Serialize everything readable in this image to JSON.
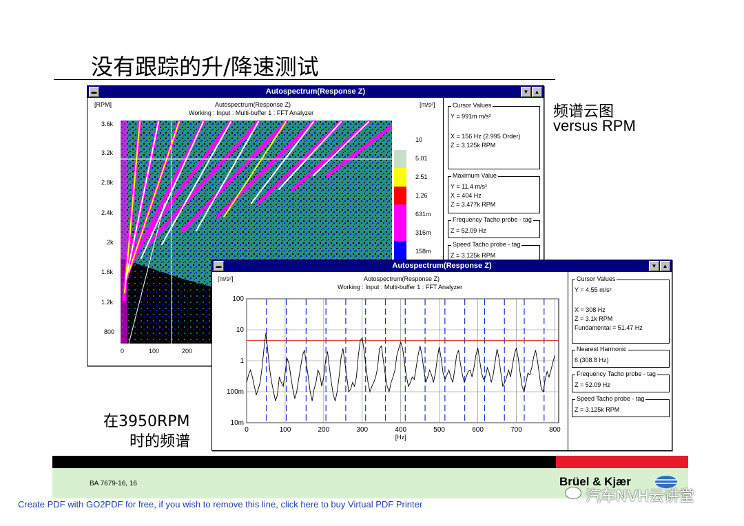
{
  "slide": {
    "title": "没有跟踪的升/降速测试",
    "annotation_top_line1": "频谱云图",
    "annotation_top_line2": "versus RPM",
    "annotation_bottom_line1": "在3950RPM",
    "annotation_bottom_line2": "时的频谱",
    "footer_code": "BA 7679-16, 16",
    "brand": "Brüel & Kjær",
    "watermark": "汽车NVH云讲堂",
    "pdf_notice": "Create PDF with GO2PDF for free, if you wish to remove this line, click here to buy Virtual PDF Printer"
  },
  "window_back": {
    "title": "Autospectrum(Response Z)",
    "plot_title": "Autospectrum(Response Z)",
    "plot_subtitle": "Working : Input : Multi-buffer 1 : FFT Analyzer",
    "y_unit": "[RPM]",
    "z_unit": "[m/s²]",
    "y_ticks": [
      "3.6k",
      "3.2k",
      "2.8k",
      "2.4k",
      "2k",
      "1.6k",
      "1.2k",
      "800"
    ],
    "x_ticks": [
      "0",
      "100",
      "200"
    ],
    "legend": [
      "10",
      "5.01",
      "2.51",
      "1.26",
      "631m",
      "316m",
      "158m"
    ],
    "legend_colors": [
      "#ffffff",
      "#c8e0c8",
      "#ffff00",
      "#ff0000",
      "#ff00ff",
      "#ff00ff",
      "#0000ff"
    ],
    "cursor_values": {
      "header": "Cursor Values",
      "y": "Y = 991m m/s²",
      "x": "X = 156 Hz  (2.995 Order)",
      "z": "Z = 3.125k RPM"
    },
    "maximum_value": {
      "header": "Maximum Value",
      "y": "Y = 11.4 m/s²",
      "x": "X = 404 Hz",
      "z": "Z = 3.477k RPM"
    },
    "freq_tacho": {
      "header": "Frequency Tacho probe - tag",
      "z": "Z = 52.09 Hz"
    },
    "speed_tacho": {
      "header": "Speed Tacho probe - tag",
      "z": "Z = 3.125k RPM"
    }
  },
  "window_front": {
    "title": "Autospectrum(Response Z)",
    "plot_title": "Autospectrum(Response Z)",
    "plot_subtitle": "Working : Input : Multi-buffer 1 : FFT Analyzer",
    "y_unit": "[m/s²]",
    "x_unit": "[Hz]",
    "cursor_values": {
      "header": "Cursor Values",
      "y": "Y = 4.55 m/s²",
      "x": "X = 308 Hz",
      "z": "Z = 3.1k RPM",
      "fund": "Fundamental = 51.47 Hz"
    },
    "nearest_harmonic": {
      "header": "Nearest Harmonic",
      "value": "6  (308.8 Hz)"
    },
    "freq_tacho": {
      "header": "Frequency Tacho probe - tag",
      "z": "Z = 52.09 Hz"
    },
    "speed_tacho": {
      "header": "Speed Tacho probe - tag",
      "z": "Z = 3.125k RPM"
    }
  },
  "chart_data": {
    "type": "line",
    "title": "Autospectrum(Response Z)",
    "subtitle": "Working : Input : Multi-buffer 1 : FFT Analyzer",
    "xlabel": "[Hz]",
    "ylabel": "[m/s²]",
    "xlim": [
      0,
      810
    ],
    "ylim": [
      0.01,
      100
    ],
    "y_scale": "log",
    "x_ticks": [
      0,
      100,
      200,
      300,
      400,
      500,
      600,
      700,
      800
    ],
    "y_tick_labels": [
      "100",
      "10",
      "1",
      "100m",
      "10m"
    ],
    "y_ticks": [
      100,
      10,
      1,
      0.1,
      0.01
    ],
    "cursor_level": 4.55,
    "harmonic_lines": [
      51.47,
      102.94,
      154.41,
      205.88,
      257.35,
      308.82,
      360.29,
      411.76,
      463.23,
      514.7,
      566.17,
      617.64,
      669.11,
      720.58,
      772.05
    ],
    "x": [
      0,
      5,
      10,
      15,
      20,
      25,
      30,
      35,
      40,
      45,
      50,
      55,
      60,
      65,
      70,
      75,
      80,
      85,
      90,
      95,
      100,
      105,
      110,
      115,
      120,
      125,
      130,
      135,
      140,
      145,
      150,
      155,
      160,
      165,
      170,
      175,
      180,
      185,
      190,
      195,
      200,
      205,
      210,
      215,
      220,
      225,
      230,
      235,
      240,
      245,
      250,
      255,
      260,
      265,
      270,
      275,
      280,
      285,
      290,
      295,
      300,
      305,
      310,
      315,
      320,
      325,
      330,
      335,
      340,
      345,
      350,
      355,
      360,
      365,
      370,
      375,
      380,
      385,
      390,
      395,
      400,
      405,
      410,
      415,
      420,
      425,
      430,
      435,
      440,
      445,
      450,
      455,
      460,
      465,
      470,
      475,
      480,
      485,
      490,
      495,
      500,
      505,
      510,
      515,
      520,
      525,
      530,
      535,
      540,
      545,
      550,
      555,
      560,
      565,
      570,
      575,
      580,
      585,
      590,
      595,
      600,
      605,
      610,
      615,
      620,
      625,
      630,
      635,
      640,
      645,
      650,
      655,
      660,
      665,
      670,
      675,
      680,
      685,
      690,
      695,
      700,
      705,
      710,
      715,
      720,
      725,
      730,
      735,
      740,
      745,
      750,
      755,
      760,
      765,
      770,
      775,
      780,
      785,
      790,
      795,
      800,
      805,
      810
    ],
    "series": [
      {
        "values": [
          0.2,
          0.35,
          0.5,
          0.3,
          0.15,
          0.08,
          0.12,
          0.2,
          0.6,
          2.5,
          8,
          2,
          0.5,
          0.2,
          0.1,
          0.05,
          0.08,
          0.3,
          0.2,
          0.15,
          0.4,
          1.2,
          0.8,
          0.3,
          0.12,
          0.06,
          0.1,
          0.25,
          0.6,
          1.5,
          2.2,
          0.8,
          0.3,
          0.1,
          0.05,
          0.12,
          0.2,
          0.5,
          0.35,
          0.15,
          0.3,
          1,
          2,
          0.6,
          0.2,
          0.08,
          0.05,
          0.1,
          0.3,
          1.2,
          2.5,
          0.9,
          0.3,
          0.1,
          0.12,
          0.2,
          0.15,
          0.3,
          1.5,
          4.5,
          5.5,
          2,
          0.6,
          0.2,
          0.1,
          0.15,
          0.2,
          0.3,
          0.6,
          2.5,
          3,
          1,
          0.35,
          0.15,
          0.1,
          0.2,
          0.3,
          0.5,
          1.5,
          2.5,
          4,
          2.5,
          0.8,
          0.3,
          0.15,
          0.2,
          0.3,
          0.25,
          0.6,
          1.5,
          3,
          1.5,
          0.5,
          0.2,
          0.3,
          0.5,
          0.35,
          0.2,
          0.4,
          1.2,
          2.8,
          1.2,
          0.4,
          0.25,
          0.35,
          0.5,
          0.3,
          0.2,
          0.5,
          1.5,
          2.2,
          0.8,
          0.35,
          0.2,
          0.3,
          0.45,
          0.5,
          0.3,
          0.6,
          1.5,
          2.6,
          1,
          0.4,
          0.25,
          0.3,
          0.6,
          0.4,
          0.2,
          0.35,
          0.9,
          2.4,
          1.2,
          0.4,
          0.15,
          0.2,
          0.3,
          0.5,
          0.3,
          0.7,
          1.6,
          2.6,
          1.2,
          0.4,
          0.15,
          0.1,
          0.2,
          0.4,
          0.35,
          0.6,
          1.3,
          2.2,
          1,
          0.35,
          0.12,
          0.1,
          0.25,
          0.45,
          0.3,
          0.5,
          0.9,
          1.5
        ]
      }
    ]
  }
}
